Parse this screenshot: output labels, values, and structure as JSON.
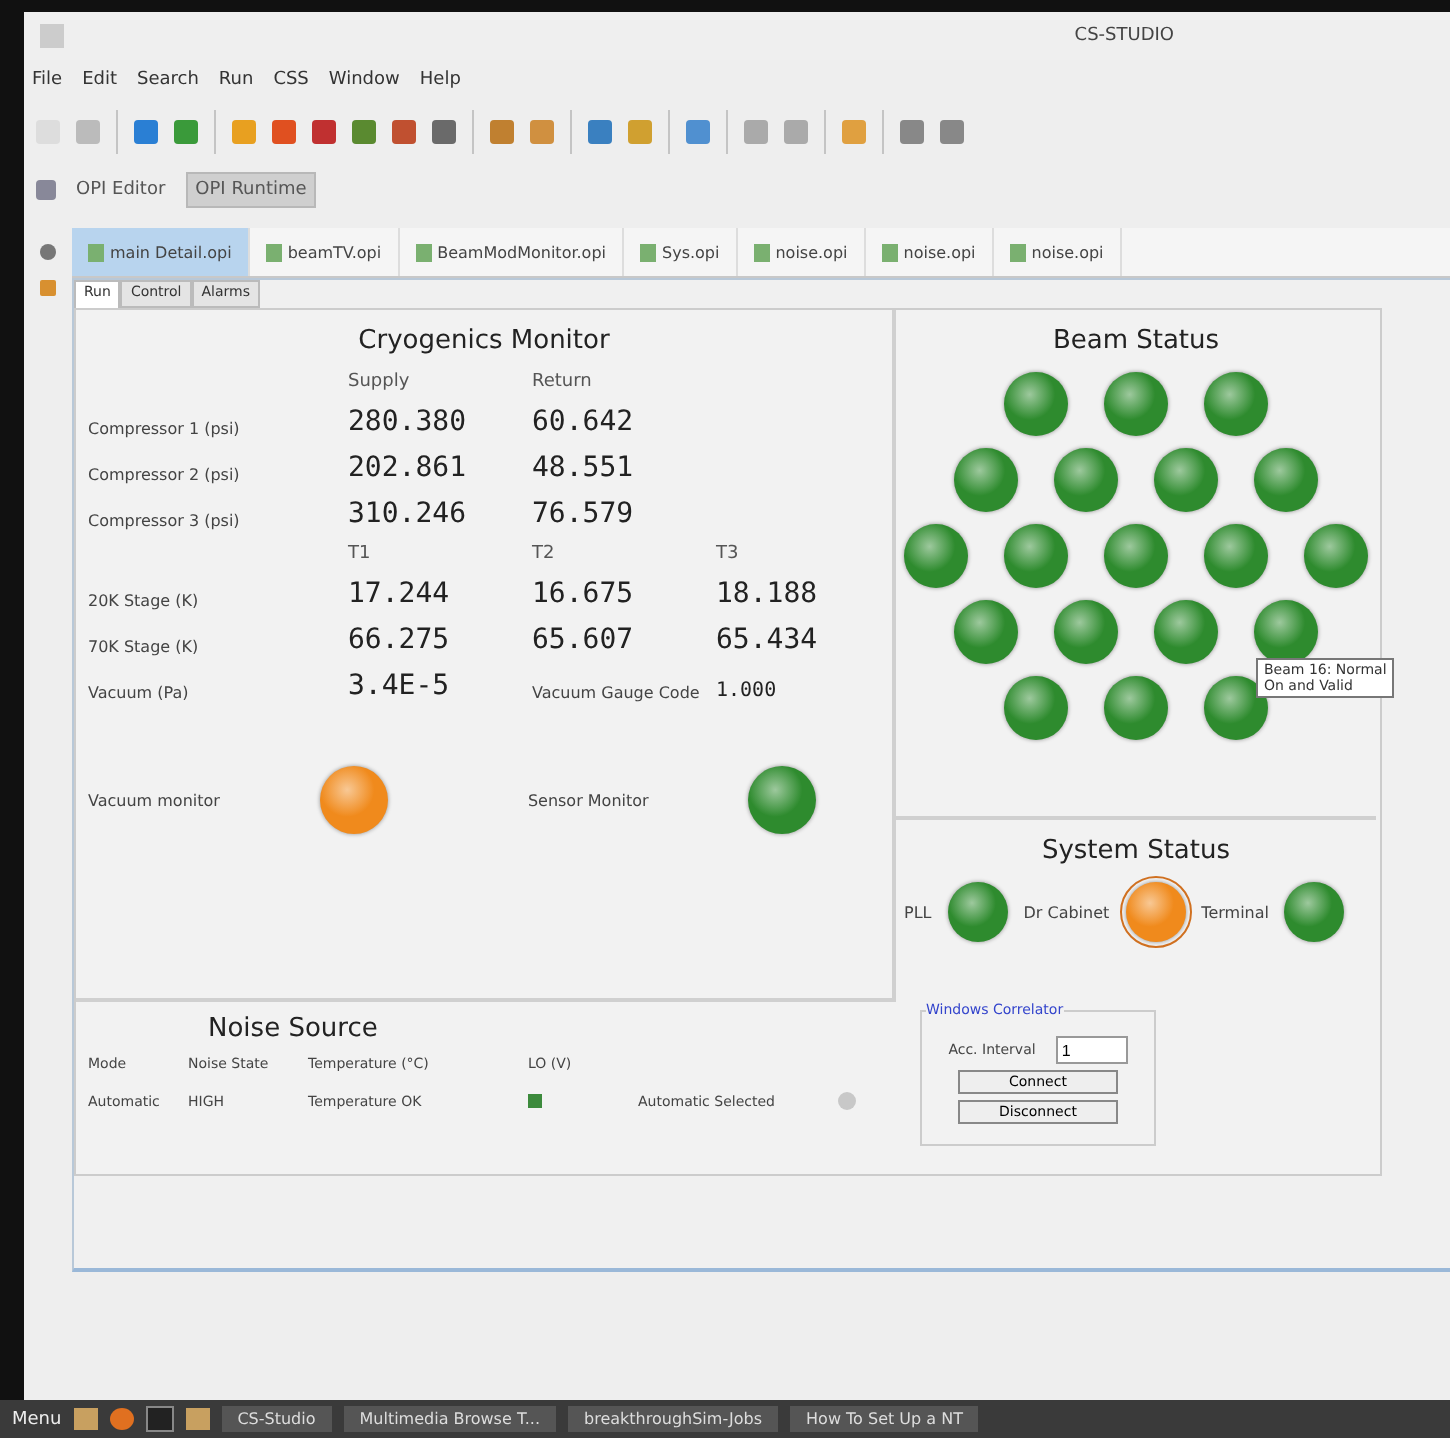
{
  "window": {
    "title": "CS-STUDIO"
  },
  "menu": [
    "File",
    "Edit",
    "Search",
    "Run",
    "CSS",
    "Window",
    "Help"
  ],
  "perspectives": [
    {
      "label": "OPI Editor",
      "selected": false
    },
    {
      "label": "OPI Runtime",
      "selected": true
    }
  ],
  "editor_tabs": [
    {
      "label": "main Detail.opi",
      "selected": true
    },
    {
      "label": "beamTV.opi",
      "selected": false
    },
    {
      "label": "BeamModMonitor.opi",
      "selected": false
    },
    {
      "label": "Sys.opi",
      "selected": false
    },
    {
      "label": "noise.opi",
      "selected": false
    },
    {
      "label": "noise.opi",
      "selected": false
    },
    {
      "label": "noise.opi",
      "selected": false
    }
  ],
  "inner_tabs": [
    {
      "label": "Run",
      "selected": true
    },
    {
      "label": "Control",
      "selected": false
    },
    {
      "label": "Alarms",
      "selected": false
    }
  ],
  "cryo": {
    "title": "Cryogenics Monitor",
    "head1": [
      "Supply",
      "Return"
    ],
    "pressures": [
      {
        "label": "Compressor 1 (psi)",
        "values": [
          "280.380",
          "60.642"
        ]
      },
      {
        "label": "Compressor 2 (psi)",
        "values": [
          "202.861",
          "48.551"
        ]
      },
      {
        "label": "Compressor 3 (psi)",
        "values": [
          "310.246",
          "76.579"
        ]
      }
    ],
    "head2": [
      "T1",
      "T2",
      "T3"
    ],
    "temps": [
      {
        "label": "20K Stage (K)",
        "values": [
          "17.244",
          "16.675",
          "18.188"
        ]
      },
      {
        "label": "70K Stage (K)",
        "values": [
          "66.275",
          "65.607",
          "65.434"
        ]
      }
    ],
    "vacuum": {
      "label": "Vacuum (Pa)",
      "value": "3.4E-5",
      "code_label": "Vacuum Gauge Code",
      "code": "1.000"
    },
    "monitors": [
      {
        "label": "Vacuum monitor",
        "color": "#f08a1c"
      },
      {
        "label": "Sensor Monitor",
        "color": "#2e8b2e"
      }
    ]
  },
  "beam": {
    "title": "Beam Status",
    "rows": [
      [
        {
          "color": "#2e8b2e"
        },
        {
          "color": "#2e8b2e"
        },
        {
          "color": "#2e8b2e"
        }
      ],
      [
        {
          "color": "#2e8b2e"
        },
        {
          "color": "#2e8b2e"
        },
        {
          "color": "#2e8b2e"
        },
        {
          "color": "#2e8b2e"
        }
      ],
      [
        {
          "color": "#2e8b2e"
        },
        {
          "color": "#2e8b2e"
        },
        {
          "color": "#2e8b2e"
        },
        {
          "color": "#2e8b2e"
        },
        {
          "color": "#2e8b2e"
        }
      ],
      [
        {
          "color": "#2e8b2e"
        },
        {
          "color": "#2e8b2e"
        },
        {
          "color": "#2e8b2e"
        },
        {
          "color": "#2e8b2e"
        }
      ],
      [
        {
          "color": "#2e8b2e"
        },
        {
          "color": "#2e8b2e"
        },
        {
          "color": "#2e8b2e"
        }
      ]
    ],
    "tooltip": [
      "Beam 16: Normal",
      "On and Valid"
    ]
  },
  "system": {
    "title": "System Status",
    "items": [
      {
        "label": "PLL",
        "color": "#2e8b2e",
        "selected": false
      },
      {
        "label": "Dr Cabinet",
        "color": "#f08a1c",
        "selected": true
      },
      {
        "label": "Terminal",
        "color": "#2e8b2e",
        "selected": false
      }
    ]
  },
  "noise": {
    "title": "Noise Source",
    "columns": [
      "Mode",
      "Noise State",
      "Temperature (°C)",
      "LO (V)"
    ],
    "row": [
      "Automatic",
      "HIGH",
      "Temperature OK"
    ],
    "indicator": {
      "color": "#3c8a3c"
    },
    "selected_label": "Automatic Selected",
    "indicator2": {
      "color": "#c8c8c8"
    }
  },
  "correlator": {
    "title": "Windows Correlator",
    "interval_label": "Acc. Interval",
    "interval": "1",
    "buttons": [
      "Connect",
      "Disconnect"
    ]
  },
  "taskbar": [
    {
      "label": "Menu",
      "kind": "start"
    },
    {
      "label": "CS-Studio",
      "kind": "task"
    },
    {
      "label": "Multimedia Browse T...",
      "kind": "task"
    },
    {
      "label": "breakthroughSim-Jobs",
      "kind": "task"
    },
    {
      "label": "How To Set Up a NT",
      "kind": "task"
    }
  ]
}
